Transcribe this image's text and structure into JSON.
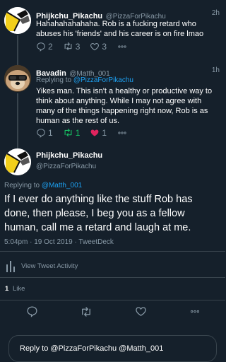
{
  "colors": {
    "background": "#15202b",
    "text": "#ffffff",
    "muted": "#8899a6",
    "accent": "#1da1f2",
    "retweet": "#17bf63",
    "like": "#e0245e",
    "divider": "#38444d"
  },
  "tweet1": {
    "name": "Phijkchu_Pikachu",
    "handle": "@PizzaForPikachu",
    "time": "2h",
    "text": "Hahahahahahaha. Rob is a fucking retard who abuses his 'friends' and his career is on fire lmao",
    "replies": "2",
    "retweets": "3",
    "likes": "3"
  },
  "tweet2": {
    "name": "Bavadin",
    "handle": "@Matth_001",
    "time": "1h",
    "replying_prefix": "Replying to ",
    "replying_to": "@PizzaForPikachu",
    "text": "Yikes man. This isn't a healthy or productive way to think about anything. While I may not agree with many of the things happening right now, Rob is as human as the rest of us.",
    "replies": "1",
    "retweets": "1",
    "likes": "1"
  },
  "main": {
    "name": "Phijkchu_Pikachu",
    "handle": "@PizzaForPikachu",
    "replying_prefix": "Replying to ",
    "replying_to": "@Matth_001",
    "text": "If I ever do anything like the stuff Rob has done, then please, I beg you as a fellow human, call me a retard and laugh at me.",
    "meta": "5:04pm · 19 Oct 2019 · TweetDeck",
    "activity": "View Tweet Activity",
    "likes_count": "1",
    "likes_label": "Like"
  },
  "reply_box": {
    "placeholder": "Reply to @PizzaForPikachu @Matth_001"
  },
  "icons": [
    "reply-icon",
    "retweet-icon",
    "like-icon",
    "more-icon",
    "chart-icon",
    "avatar-pikachu",
    "avatar-doge"
  ]
}
